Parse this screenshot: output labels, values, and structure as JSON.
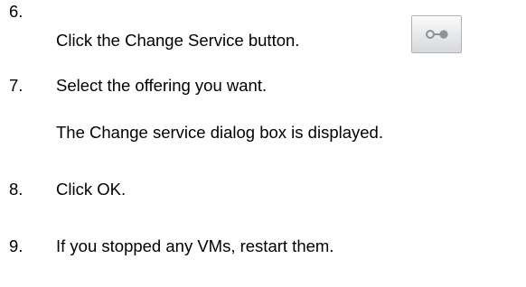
{
  "steps": [
    {
      "number": "6.",
      "text": "Click the Change Service button."
    },
    {
      "number": "7.",
      "text": "Select the offering you want."
    },
    {
      "number": "",
      "text": "The Change service dialog box is displayed."
    },
    {
      "number": "8.",
      "text": "Click OK."
    },
    {
      "number": "9.",
      "text": "If you stopped any VMs, restart them."
    }
  ],
  "icons": {
    "change_service": "change-service-icon"
  },
  "colors": {
    "text": "#000000",
    "button_border": "#aeb3b8",
    "icon": "#8c9297"
  }
}
